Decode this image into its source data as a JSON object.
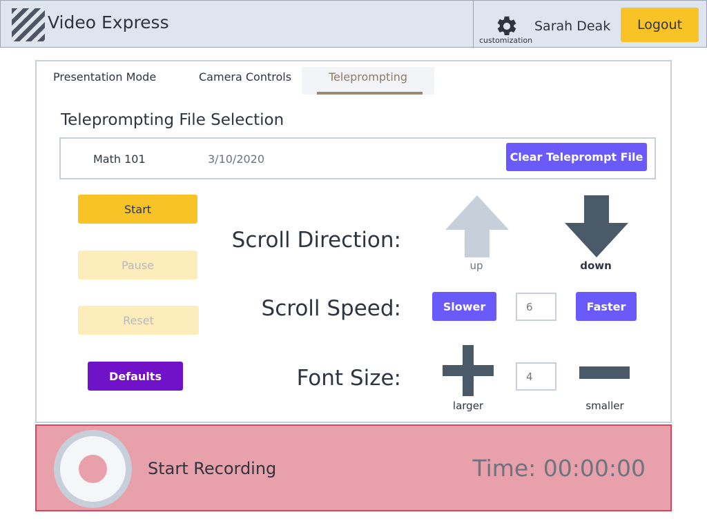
{
  "header": {
    "app_title": "Video Express",
    "logo_icon": "striped-logo-icon",
    "settings_icon": "gear-icon",
    "settings_label": "customization",
    "user_name": "Sarah Deak",
    "logout_label": "Logout"
  },
  "tabs": [
    {
      "label": "Presentation Mode",
      "active": false
    },
    {
      "label": "Camera Controls",
      "active": false
    },
    {
      "label": "Teleprompting",
      "active": true
    }
  ],
  "file_selection": {
    "title": "Teleprompting File Selection",
    "file_name": "Math 101",
    "file_date": "3/10/2020",
    "clear_label": "Clear Teleprompt File"
  },
  "controls": {
    "start": "Start",
    "pause": "Pause",
    "reset": "Reset",
    "defaults": "Defaults"
  },
  "scroll_direction": {
    "label": "Scroll Direction:",
    "up_label": "up",
    "down_label": "down",
    "selected": "down"
  },
  "scroll_speed": {
    "label": "Scroll Speed:",
    "slower_label": "Slower",
    "faster_label": "Faster",
    "value_placeholder": "6"
  },
  "font_size": {
    "label": "Font Size:",
    "larger_label": "larger",
    "smaller_label": "smaller",
    "value_placeholder": "4"
  },
  "recording": {
    "label": "Start Recording",
    "time": "Time: 00:00:00"
  },
  "colors": {
    "accent_yellow": "#f8c327",
    "accent_purple": "#6a5af9",
    "defaults_purple": "#7012c7",
    "record_bar": "#e8a0aa",
    "record_border": "#d9435d"
  }
}
